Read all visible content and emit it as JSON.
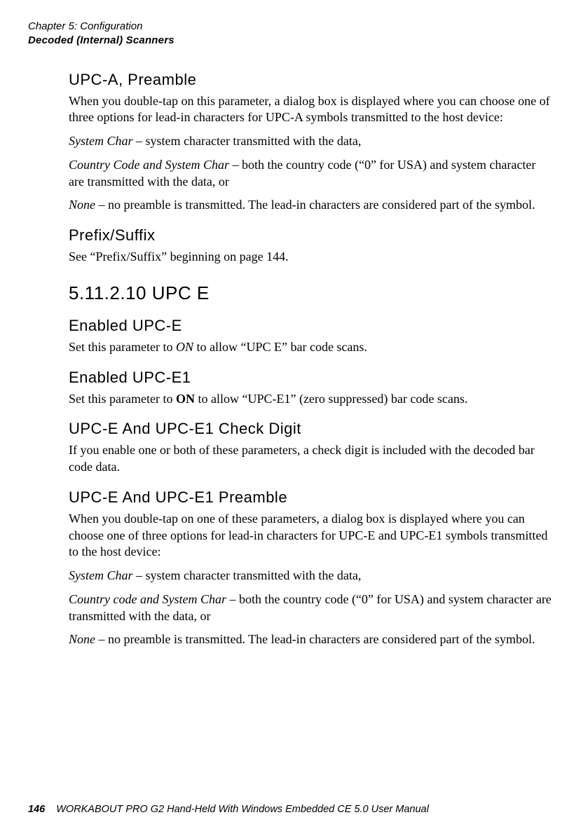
{
  "header": {
    "chapter": "Chapter 5: Configuration",
    "section": "Decoded (Internal) Scanners"
  },
  "s1": {
    "heading": "UPC-A, Preamble",
    "p1": "When you double-tap on this parameter, a dialog box is displayed where you can choose one of three options for lead-in characters for UPC-A symbols transmitted to the host device:",
    "p2a": "System Char",
    "p2b": " – system character transmitted with the data,",
    "p3a": "Country Code and System Char",
    "p3b": " – both the country code (“0” for USA) and system character are transmitted with the data, or",
    "p4a": "None",
    "p4b": " – no preamble is transmitted. The lead-in characters are considered part of the symbol."
  },
  "s2": {
    "heading": "Prefix/Suffix",
    "p1": "See “Prefix/Suffix” beginning on page 144."
  },
  "s3": {
    "heading": "5.11.2.10 UPC E"
  },
  "s4": {
    "heading": "Enabled UPC-E",
    "p1a": "Set this parameter to ",
    "p1b": "ON",
    "p1c": " to allow “UPC E” bar code scans."
  },
  "s5": {
    "heading": "Enabled UPC-E1",
    "p1a": "Set this parameter to ",
    "p1b": "ON",
    "p1c": " to allow “UPC-E1” (zero suppressed) bar code scans."
  },
  "s6": {
    "heading": "UPC-E And UPC-E1 Check Digit",
    "p1": "If you enable one or both of these parameters, a check digit is included with the decoded bar code data."
  },
  "s7": {
    "heading": "UPC-E And UPC-E1 Preamble",
    "p1": "When you double-tap on one of these parameters, a dialog box is displayed where you can choose one of three options for lead-in characters for UPC-E and UPC-E1 symbols transmitted to the host device:",
    "p2a": "System Char",
    "p2b": " – system character transmitted with the data,",
    "p3a": "Country code and System Char",
    "p3b": " – both the country code (“0” for USA) and system character are transmitted with the data, or",
    "p4a": "None",
    "p4b": " – no preamble is transmitted. The lead-in characters are considered part of the symbol."
  },
  "footer": {
    "page": "146",
    "title": "WORKABOUT PRO G2 Hand-Held With Windows Embedded CE 5.0 User Manual"
  }
}
